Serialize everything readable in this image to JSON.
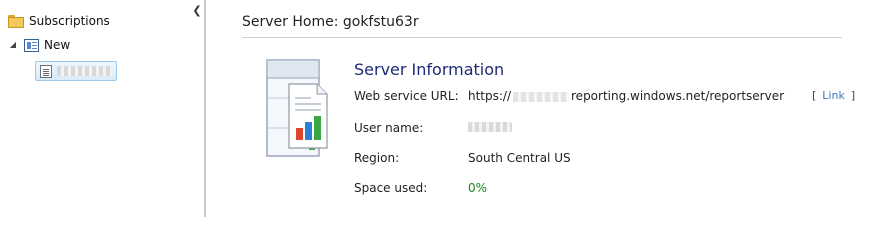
{
  "sidebar": {
    "collapse_glyph": "❮",
    "items": [
      {
        "label": "Subscriptions",
        "icon": "folder-icon"
      },
      {
        "label": "New",
        "icon": "list-icon",
        "expander": "◢"
      },
      {
        "label": "gokfstu63r",
        "icon": "report-icon",
        "redacted": true
      }
    ]
  },
  "main": {
    "home_title": "Server Home: gokfstu63r",
    "info_title": "Server Information",
    "fields": {
      "url_label": "Web service URL:",
      "url_prefix": "https://",
      "url_suffix": "reporting.windows.net/reportserver",
      "link_open": "[",
      "link_label": "Link",
      "link_close": "]",
      "user_label": "User name:",
      "region_label": "Region:",
      "region_value": "South Central US",
      "space_label": "Space used:",
      "space_value": "0%"
    }
  },
  "colors": {
    "title_blue": "#1e2a78",
    "link_blue": "#3b78c8",
    "space_green": "#178a17",
    "chart_red": "#e0452e",
    "chart_blue": "#2f7fd6",
    "chart_green": "#3aa845"
  }
}
